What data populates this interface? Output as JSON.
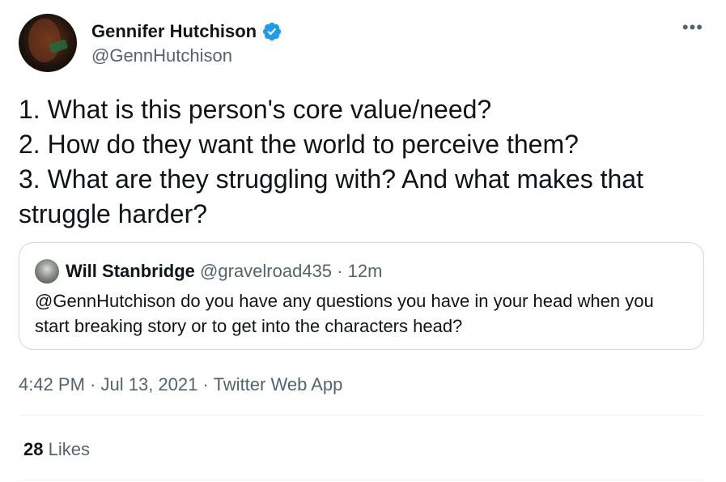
{
  "author": {
    "name": "Gennifer Hutchison",
    "handle": "@GennHutchison",
    "verified": true
  },
  "more_menu": "•••",
  "tweet_lines": [
    "1. What is this person's core value/need?",
    "2. How do they want the world to perceive them?",
    "3. What are they struggling with? And what makes that",
    "struggle harder?"
  ],
  "quoted": {
    "name": "Will Stanbridge",
    "handle": "@gravelroad435",
    "separator": "·",
    "time": "12m",
    "text_lines": [
      "@GennHutchison do you have any questions you have in your head when you",
      "start breaking story or to get into the characters head?"
    ]
  },
  "meta": {
    "time": "4:42 PM",
    "sep1": "·",
    "date": "Jul 13, 2021",
    "sep2": "·",
    "client": "Twitter Web App"
  },
  "stats": {
    "likes_count": "28",
    "likes_label": "Likes"
  },
  "colors": {
    "verified_badge": "#1d9bf0",
    "secondary_text": "#536471",
    "border": "#cfd9de"
  }
}
